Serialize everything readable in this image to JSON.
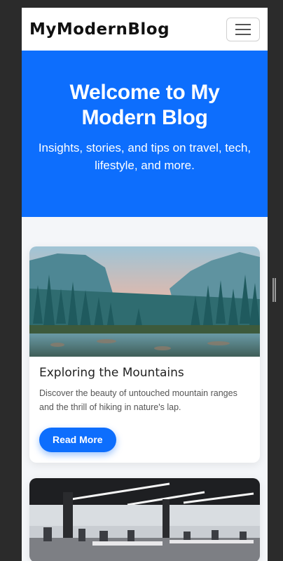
{
  "navbar": {
    "brand": "MyModernBlog",
    "toggle_icon": "hamburger-menu-icon"
  },
  "hero": {
    "title": "Welcome to My Modern Blog",
    "subtitle": "Insights, stories, and tips on travel, tech, lifestyle, and more."
  },
  "posts": [
    {
      "image": "mountain-lake-forest-photo",
      "title": "Exploring the Mountains",
      "text": "Discover the beauty of untouched mountain ranges and the thrill of hiking in nature's lap.",
      "button": "Read More"
    },
    {
      "image": "open-office-workspace-photo"
    }
  ],
  "colors": {
    "primary": "#0d6efd",
    "page_bg": "#f4f6f9",
    "outer_bg": "#2b2b2b"
  }
}
